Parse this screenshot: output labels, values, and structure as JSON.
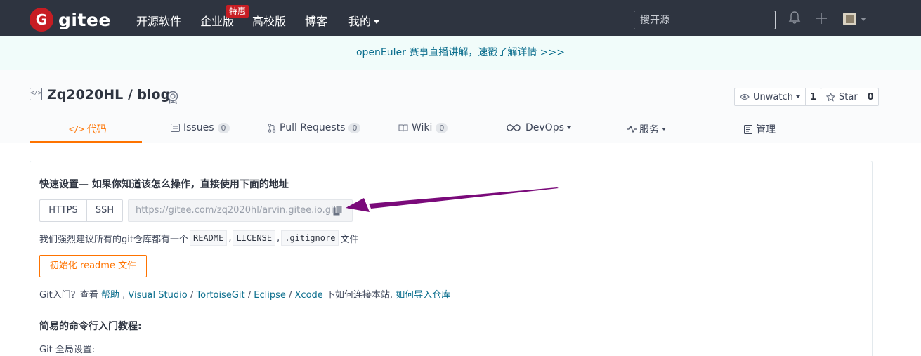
{
  "nav": {
    "logo_glyph": "G",
    "logo_text": "gitee",
    "items": [
      "开源软件",
      "企业版",
      "高校版",
      "博客",
      "我的"
    ],
    "enterprise_badge": "特惠",
    "search_placeholder": "搜开源"
  },
  "banner": {
    "text": "openEuler 赛事直播讲解，速戳了解详情 >>>"
  },
  "repo": {
    "title": "Zq2020HL / blog",
    "watch_label": "Unwatch",
    "watch_count": "1",
    "star_label": "Star",
    "star_count": "0"
  },
  "tabs": [
    {
      "label": "代码",
      "count": null,
      "active": true
    },
    {
      "label": "Issues",
      "count": "0"
    },
    {
      "label": "Pull Requests",
      "count": "0"
    },
    {
      "label": "Wiki",
      "count": "0"
    },
    {
      "label": "DevOps",
      "count": null
    },
    {
      "label": "服务",
      "count": null
    },
    {
      "label": "管理",
      "count": null
    }
  ],
  "quick_setup": {
    "title": "快速设置— 如果你知道该怎么操作，直接使用下面的地址",
    "protocols": [
      "HTTPS",
      "SSH"
    ],
    "url": "https://gitee.com/zq2020hl/arvin.gitee.io.git",
    "recommend_prefix": "我们强烈建议所有的git仓库都有一个",
    "recommend_files": [
      "README",
      "LICENSE",
      ".gitignore"
    ],
    "recommend_suffix": "文件",
    "init_button": "初始化 readme 文件",
    "help_prefix": "Git入门？查看 ",
    "help_link": "帮助",
    "help_sep1": " , ",
    "tools": [
      "Visual Studio",
      "TortoiseGit",
      "Eclipse",
      "Xcode"
    ],
    "help_mid": " 下如何连接本站, ",
    "import_link": "如何导入仓库",
    "cli_title": "简易的命令行入门教程:",
    "global_setting": "Git 全局设置:"
  },
  "colors": {
    "nav_bg": "#2e3440",
    "brand_red": "#c71d23",
    "accent_orange": "#fe7300",
    "link_teal": "#0b6e8d",
    "annotation_arrow": "#7a0a7a"
  }
}
